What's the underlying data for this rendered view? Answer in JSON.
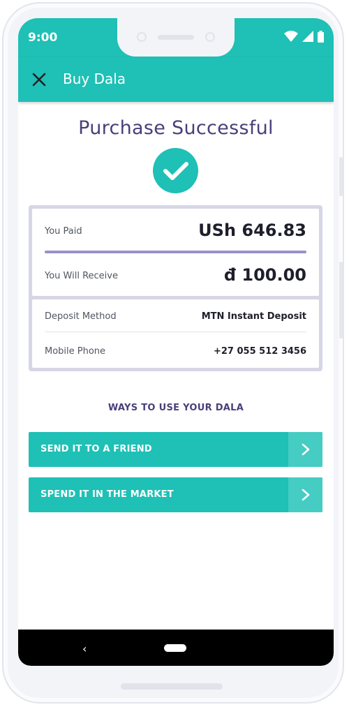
{
  "status": {
    "time": "9:00",
    "icons": [
      "wifi-icon",
      "signal-icon",
      "battery-icon"
    ]
  },
  "appbar": {
    "title": "Buy Dala",
    "close_icon": "close-icon"
  },
  "success": {
    "title": "Purchase Successful",
    "icon": "checkmark-icon"
  },
  "summary": {
    "paid_label": "You Paid",
    "paid_value": "USh 646.83",
    "receive_label": "You Will Receive",
    "receive_value": "đ 100.00",
    "deposit_label": "Deposit Method",
    "deposit_value": "MTN Instant Deposit",
    "phone_label": "Mobile Phone",
    "phone_value": "+27 055 512 3456"
  },
  "ways": {
    "title": "WAYS TO USE YOUR DALA",
    "actions": [
      {
        "label": "SEND IT TO A FRIEND",
        "icon": "chevron-right-icon"
      },
      {
        "label": "SPEND IT IN THE MARKET",
        "icon": "chevron-right-icon"
      }
    ]
  },
  "navbar": {
    "back_glyph": "‹"
  },
  "colors": {
    "accent": "#1fc0b5",
    "accent_light": "#45ccc3",
    "title_purple": "#4a3f7a",
    "divider_purple": "#9a91c8"
  }
}
